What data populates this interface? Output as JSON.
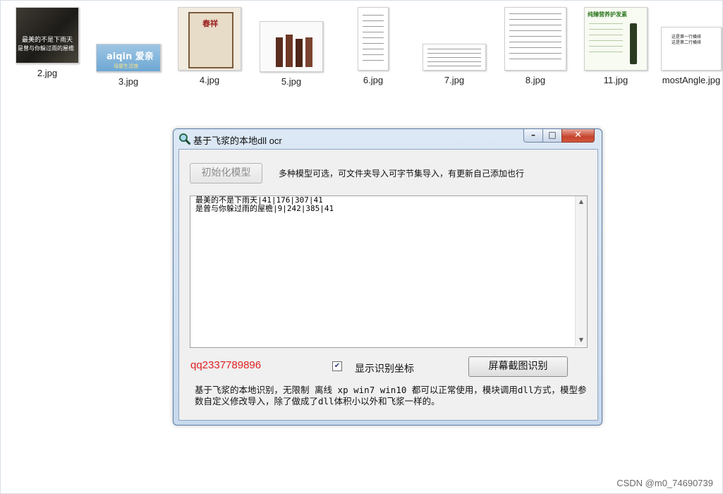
{
  "desktop": {
    "files": [
      {
        "name": "2.jpg",
        "overlay": [
          "最美的不是下雨天",
          "是曾与你躲过雨的屋檐"
        ]
      },
      {
        "name": "3.jpg",
        "overlay": [
          "aiqin 爱亲",
          "母婴生活馆"
        ]
      },
      {
        "name": "4.jpg",
        "overlay": [
          "春祥"
        ]
      },
      {
        "name": "5.jpg",
        "overlay": []
      },
      {
        "name": "6.jpg",
        "overlay": []
      },
      {
        "name": "7.jpg",
        "overlay": []
      },
      {
        "name": "8.jpg",
        "overlay": []
      },
      {
        "name": "11.jpg",
        "overlay": [
          "纯臻营养护发素"
        ]
      },
      {
        "name": "mostAngle.jpg",
        "overlay": [
          "这是第一行横排",
          "这是第二行横排"
        ]
      }
    ]
  },
  "window": {
    "title": "基于飞浆的本地dll ocr",
    "controls": {
      "minimize": "–",
      "maximize": "□",
      "close": "✕"
    },
    "init_button": "初始化模型",
    "info_text": "多种模型可选，可文件夹导入可字节集导入，有更新自己添加也行",
    "output_text": "最美的不是下雨天|41|176|307|41\n是曾与你躲过雨的屋檐|9|242|385|41",
    "qq": "qq2337789896",
    "show_coords": {
      "label": "显示识别坐标",
      "checked": true
    },
    "screenshot_button": "屏幕截图识别",
    "description": "基于飞浆的本地识别，无限制 离线 xp win7 win10 都可以正常使用，模块调用dll方式，模型参数自定义修改导入，除了做成了dll体积小以外和飞浆一样的。"
  },
  "watermark": "CSDN @m0_74690739",
  "colors": {
    "qq_text": "#e02020",
    "window_border": "#5d7fa8",
    "close_button": "#c5442d"
  }
}
